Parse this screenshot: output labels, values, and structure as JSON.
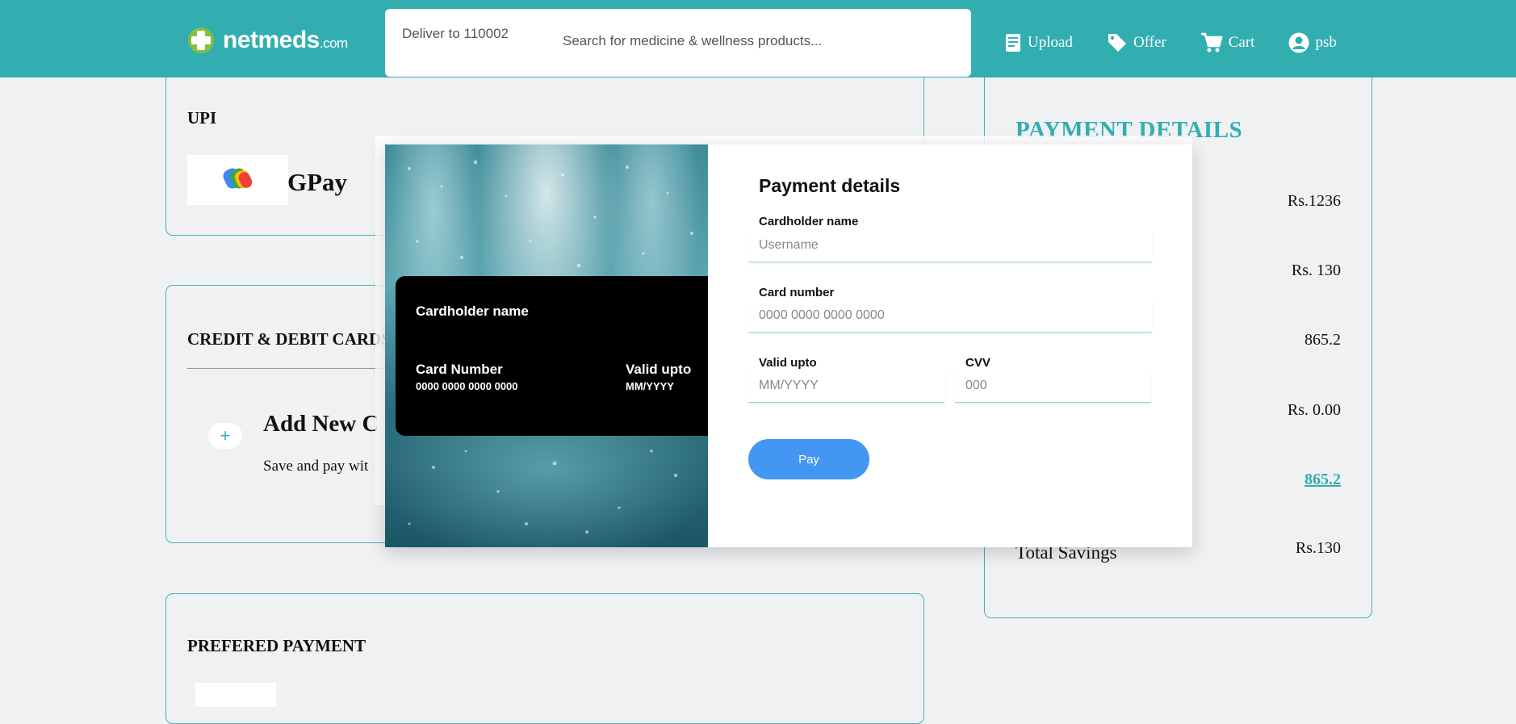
{
  "header": {
    "logo_main": "netmeds",
    "logo_suffix": ".com",
    "deliver_text": "Deliver to 110002",
    "search_placeholder": "Search for medicine & wellness products...",
    "nav": [
      {
        "label": "Upload",
        "icon": "upload-icon"
      },
      {
        "label": "Offer",
        "icon": "tag-icon"
      },
      {
        "label": "Cart",
        "icon": "cart-icon"
      },
      {
        "label": "psb",
        "icon": "user-icon"
      }
    ]
  },
  "upi": {
    "title": "UPI",
    "gpay_label": "GPay",
    "icon": "gpay-logo"
  },
  "cards_section": {
    "title": "CREDIT & DEBIT CARDS",
    "add_new": "Add New C",
    "save_pay": "Save and pay wit",
    "plus": "+"
  },
  "preferred": {
    "title": "PREFERED PAYMENT"
  },
  "summary": {
    "title": "PAYMENT DETAILS",
    "values": [
      "Rs.1236",
      "Rs. 130",
      "865.2",
      "Rs. 0.00",
      "865.2",
      "Rs.130"
    ],
    "total_savings_label": "Total Savings"
  },
  "modal": {
    "card_preview": {
      "holder_label": "Cardholder name",
      "number_label": "Card Number",
      "number_value": "0000 0000 0000 0000",
      "valid_label": "Valid upto",
      "valid_value": "MM/YYYY"
    },
    "form": {
      "title": "Payment details",
      "name_label": "Cardholder name",
      "name_placeholder": "Username",
      "number_label": "Card number",
      "number_placeholder": "0000 0000 0000 0000",
      "valid_label": "Valid upto",
      "valid_placeholder": "MM/YYYY",
      "cvv_label": "CVV",
      "cvv_placeholder": "000",
      "pay_label": "Pay"
    }
  },
  "colors": {
    "brand": "#32aeb1",
    "pay_button": "#4396f2",
    "background": "#eff1f3"
  }
}
